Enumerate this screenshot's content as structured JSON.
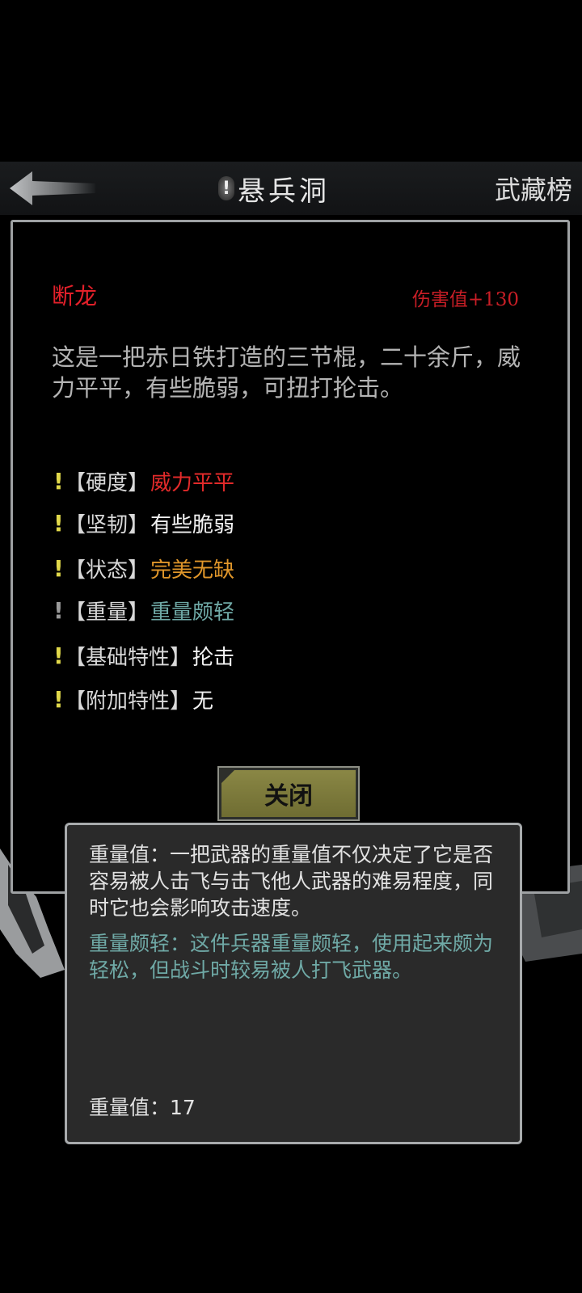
{
  "header": {
    "title": "悬兵洞",
    "title_badge": "!",
    "rank_label": "武藏榜"
  },
  "weapon": {
    "name": "断龙",
    "damage": "伤害值+130",
    "description": "这是一把赤日铁打造的三节棍，二十余斤，威力平平，有些脆弱，可扭打抡击。"
  },
  "attributes": [
    {
      "bang": "!",
      "label": "【硬度】",
      "value": "威力平平",
      "color": "#e22a2a",
      "bang_color": "yellow"
    },
    {
      "bang": "!",
      "label": "【坚韧】",
      "value": "有些脆弱",
      "color": "#f2f2f2",
      "bang_color": "yellow"
    },
    {
      "bang": "!",
      "label": "【状态】",
      "value": "完美无缺",
      "color": "#e0962a",
      "bang_color": "yellow"
    },
    {
      "bang": "!",
      "label": "【重量】",
      "value": "重量颇轻",
      "color": "#6fa9a6",
      "bang_color": "grey"
    },
    {
      "bang": "!",
      "label": "【基础特性】",
      "value": "抡击",
      "color": "#f2f2f2",
      "bang_color": "yellow"
    },
    {
      "bang": "!",
      "label": "【附加特性】",
      "value": "无",
      "color": "#f2f2f2",
      "bang_color": "yellow"
    }
  ],
  "close_label": "关闭",
  "tooltip": {
    "main": "重量值：一把武器的重量值不仅决定了它是否容易被人击飞与击飞他人武器的难易程度，同时它也会影响攻击速度。",
    "sub": "重量颇轻：这件兵器重量颇轻，使用起来颇为轻松，但战斗时较易被人打飞武器。",
    "value_line": "重量值：17"
  },
  "colors": {
    "accent_red": "#e3202a",
    "teal": "#6fa9a6",
    "warning_yellow": "#e0d84a",
    "button_olive": "#7d7a3c"
  },
  "icons": {
    "back": "arrow-left-icon",
    "badge": "exclamation-icon"
  }
}
